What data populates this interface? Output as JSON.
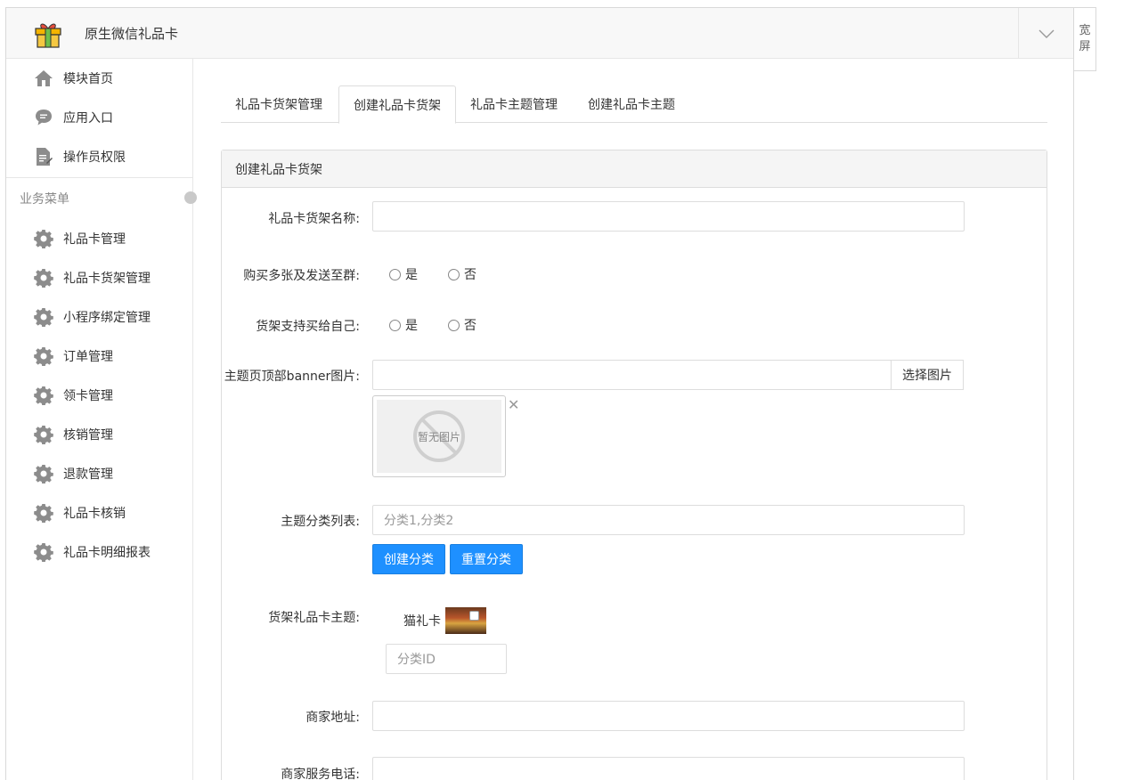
{
  "header": {
    "title": "原生微信礼品卡"
  },
  "wide_screen": {
    "chars": [
      "宽",
      "屏"
    ]
  },
  "sidebar": {
    "top_items": [
      {
        "label": "模块首页",
        "icon": "home-icon"
      },
      {
        "label": "应用入口",
        "icon": "chat-bubble-icon"
      },
      {
        "label": "操作员权限",
        "icon": "document-edit-icon"
      }
    ],
    "section_label": "业务菜单",
    "menu_items": [
      {
        "label": "礼品卡管理"
      },
      {
        "label": "礼品卡货架管理"
      },
      {
        "label": "小程序绑定管理"
      },
      {
        "label": "订单管理"
      },
      {
        "label": "领卡管理"
      },
      {
        "label": "核销管理"
      },
      {
        "label": "退款管理"
      },
      {
        "label": "礼品卡核销"
      },
      {
        "label": "礼品卡明细报表"
      }
    ]
  },
  "tabs": [
    {
      "label": "礼品卡货架管理",
      "active": false
    },
    {
      "label": "创建礼品卡货架",
      "active": true
    },
    {
      "label": "礼品卡主题管理",
      "active": false
    },
    {
      "label": "创建礼品卡主题",
      "active": false
    }
  ],
  "panel": {
    "title": "创建礼品卡货架",
    "fields": {
      "shelf_name": {
        "label": "礼品卡货架名称:",
        "value": ""
      },
      "buy_multiple": {
        "label": "购买多张及发送至群:",
        "options": [
          "是",
          "否"
        ]
      },
      "buy_for_self": {
        "label": "货架支持买给自己:",
        "options": [
          "是",
          "否"
        ]
      },
      "banner": {
        "label": "主题页顶部banner图片:",
        "value": "",
        "button": "选择图片",
        "placeholder_text": "暂无图片"
      },
      "categories": {
        "label": "主题分类列表:",
        "placeholder": "分类1,分类2",
        "create_button": "创建分类",
        "reset_button": "重置分类"
      },
      "themes": {
        "label": "货架礼品卡主题:",
        "theme_name": "猫礼卡",
        "category_placeholder": "分类ID"
      },
      "merchant_address": {
        "label": "商家地址:",
        "value": ""
      },
      "merchant_phone": {
        "label": "商家服务电话:",
        "value": ""
      }
    }
  },
  "colors": {
    "primary_button": "#1e90ff",
    "icon_gray": "#8c8c8c"
  }
}
